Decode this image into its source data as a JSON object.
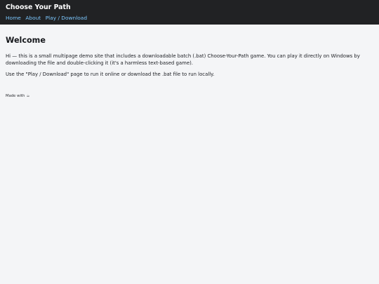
{
  "header": {
    "title": "Choose Your Path",
    "nav": [
      {
        "label": "Home"
      },
      {
        "label": "About"
      },
      {
        "label": "Play / Download"
      }
    ]
  },
  "main": {
    "heading": "Welcome",
    "paragraphs": [
      "Hi — this is a small multipage demo site that includes a downloadable batch (.bat) Choose-Your-Path game. You can play it directly on Windows by downloading the file and double-clicking it (it's a harmless text-based game).",
      "Use the \"Play / Download\" page to run it online or download the .bat file to run locally."
    ]
  },
  "footer": {
    "text": "Made with",
    "icon": "coffee-cup-icon",
    "icon_glyph": "☕"
  }
}
